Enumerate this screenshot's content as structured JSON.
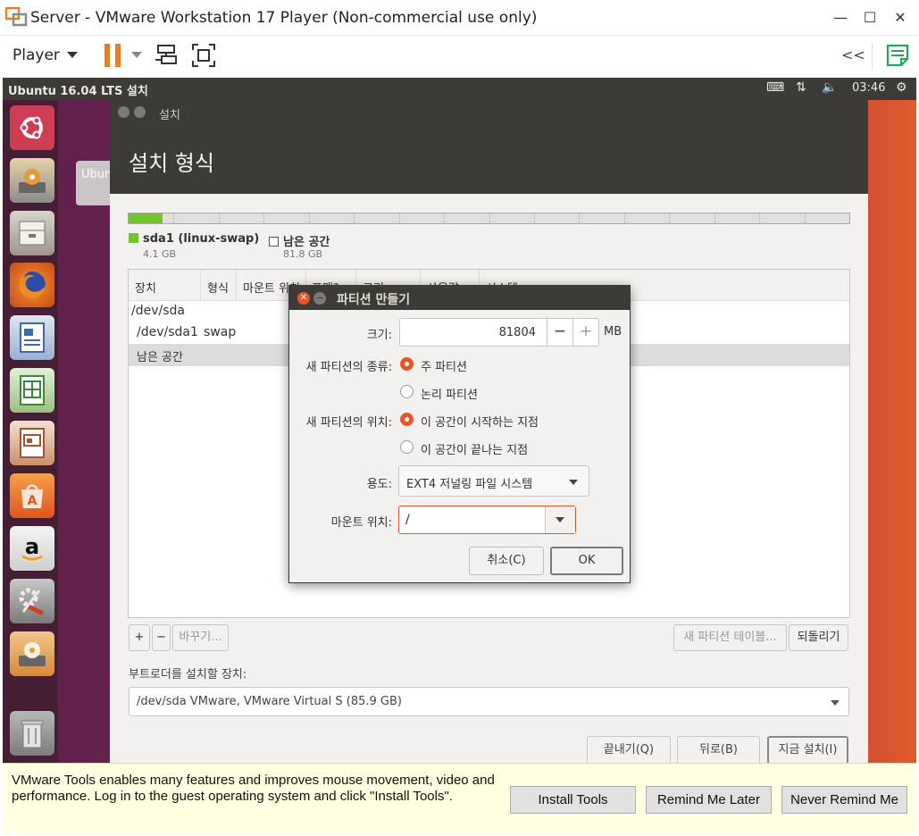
{
  "window": {
    "title": "Server - VMware Workstation 17 Player (Non-commercial use only)",
    "minimize": "—",
    "maximize": "☐",
    "close": "✕"
  },
  "toolbar": {
    "player_label": "Player",
    "back_label": "<<"
  },
  "ubuntu_panel": {
    "title": "Ubuntu 16.04 LTS 설치",
    "keyboard_icon": "⌨",
    "network_icon": "⇅",
    "volume_icon": "🔈",
    "time": "03:46",
    "gear_icon": "⚙"
  },
  "ghost_text": "Ubun",
  "installer": {
    "window_title": "설치",
    "header": "설치 형식",
    "legend": [
      {
        "name": "sda1 (linux-swap)",
        "size": "4.1 GB",
        "color": "#73c32c"
      },
      {
        "name": "남은 공간",
        "size": "81.8 GB",
        "color": "#ffffff"
      }
    ],
    "usage_fraction": 0.047,
    "table": {
      "columns": [
        "장치",
        "형식",
        "마운트 위치",
        "포맷?",
        "크기",
        "사용량",
        "시스템"
      ],
      "rows": [
        {
          "device": "/dev/sda",
          "type": ""
        },
        {
          "device": "/dev/sda1",
          "type": "swap"
        },
        {
          "device": "남은 공간",
          "type": "",
          "selected": true
        }
      ]
    },
    "buttons": {
      "add": "+",
      "remove": "−",
      "change": "바꾸기...",
      "new_table": "새 파티션 테이블...",
      "revert": "되돌리기"
    },
    "bootloader_label": "부트로더를 설치할 장치:",
    "bootloader_value": "/dev/sda VMware, VMware Virtual S (85.9 GB)",
    "nav": {
      "quit": "끝내기(Q)",
      "back": "뒤로(B)",
      "install": "지금 설치(I)"
    }
  },
  "dialog": {
    "title": "파티션 만들기",
    "size_label": "크기:",
    "size_value": "81804",
    "size_minus": "−",
    "size_plus": "+",
    "size_unit": "MB",
    "type_label": "새 파티션의 종류:",
    "type_options": [
      {
        "label": "주 파티션",
        "selected": true
      },
      {
        "label": "논리 파티션",
        "selected": false
      }
    ],
    "location_label": "새 파티션의 위치:",
    "location_options": [
      {
        "label": "이 공간이 시작하는 지점",
        "selected": true
      },
      {
        "label": "이 공간이 끝나는 지점",
        "selected": false
      }
    ],
    "use_label": "용도:",
    "use_value": "EXT4 저널링 파일 시스템",
    "mount_label": "마운트 위치:",
    "mount_value": "/",
    "cancel": "취소(C)",
    "ok": "OK"
  },
  "notification": {
    "message": "VMware Tools enables many features and improves mouse movement, video and performance. Log in to the guest operating system and click \"Install Tools\".",
    "install": "Install Tools",
    "remind_later": "Remind Me Later",
    "never_remind": "Never Remind Me"
  },
  "colors": {
    "ubuntu_orange": "#e6562a",
    "panel_dark": "#3c3b37",
    "vmware_orange": "#f07a22",
    "swap_green": "#73c32c",
    "notification_bg": "#ffffe1"
  },
  "launcher_icons": [
    "ubuntu-dash-icon",
    "installer-icon",
    "files-icon",
    "firefox-icon",
    "writer-icon",
    "calc-icon",
    "impress-icon",
    "software-center-icon",
    "amazon-icon",
    "settings-icon",
    "installer-active-icon",
    "trash-icon"
  ]
}
